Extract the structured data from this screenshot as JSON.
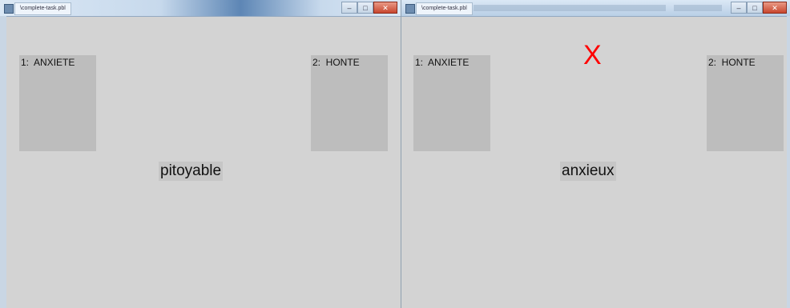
{
  "left_window": {
    "title": "\\complete-task.pbl",
    "box_1_label": "1:  ANXIETE",
    "box_2_label": "2:  HONTE",
    "word": "pitoyable"
  },
  "right_window": {
    "title": "\\complete-task.pbl",
    "box_1_label": "1:  ANXIETE",
    "box_2_label": "2:  HONTE",
    "feedback": "X",
    "word": "anxieux"
  },
  "controls": {
    "minimize": "–",
    "maximize": "□",
    "close": "✕"
  },
  "colors": {
    "background": "#d3d3d3",
    "box": "#bdbdbd",
    "feedback": "#ff0000"
  }
}
